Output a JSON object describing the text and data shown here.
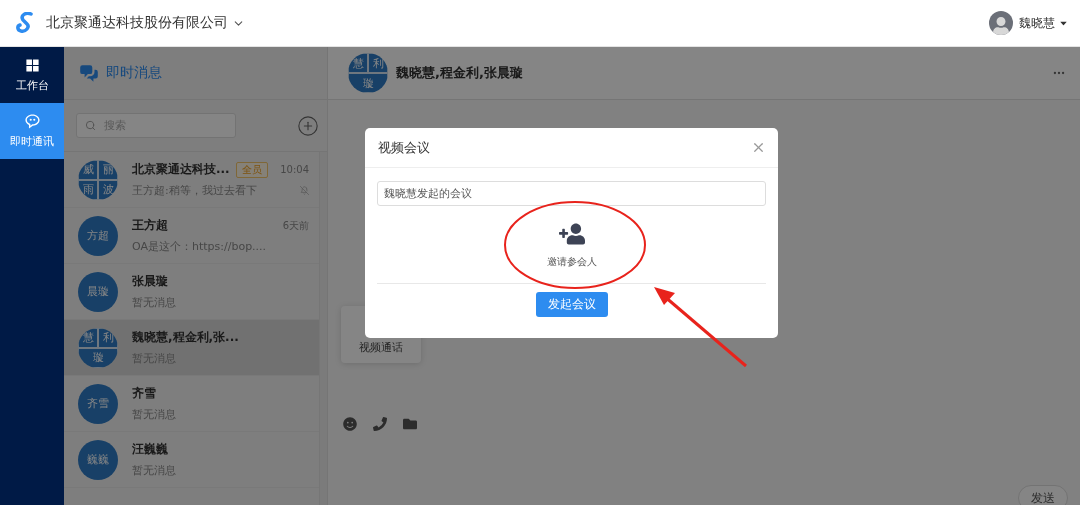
{
  "header": {
    "company": "北京聚通达科技股份有限公司",
    "user": "魏晓慧"
  },
  "nav": [
    {
      "label": "工作台",
      "selected": false
    },
    {
      "label": "即时通讯",
      "selected": true
    }
  ],
  "conversations": {
    "title": "即时消息",
    "search_placeholder": "搜索",
    "items": [
      {
        "avatar": [
          "威",
          "丽",
          "雨",
          "波"
        ],
        "name": "北京聚通达科技...",
        "tag": "全员",
        "time": "10:04",
        "preview": "王方超:稍等，我过去看下",
        "muted": true,
        "selected": false
      },
      {
        "avatar": [
          "方超"
        ],
        "name": "王方超",
        "time": "6天前",
        "preview": "OA是这个：https://bop....",
        "muted": false,
        "selected": false
      },
      {
        "avatar": [
          "晨璇"
        ],
        "name": "张晨璇",
        "preview": "暂无消息",
        "muted": false,
        "selected": false
      },
      {
        "avatar": [
          "慧",
          "利",
          "璇"
        ],
        "name": "魏晓慧,程金利,张...",
        "preview": "暂无消息",
        "muted": false,
        "selected": true
      },
      {
        "avatar": [
          "齐雪"
        ],
        "name": "齐雪",
        "preview": "暂无消息",
        "muted": false,
        "selected": false
      },
      {
        "avatar": [
          "巍巍"
        ],
        "name": "汪巍巍",
        "preview": "暂无消息",
        "muted": false,
        "selected": false
      }
    ]
  },
  "chat": {
    "title": "魏晓慧,程金利,张晨璇",
    "avatar": [
      "慧",
      "利",
      "璇"
    ],
    "popover": [
      "视频通话"
    ],
    "send": "发送"
  },
  "modal": {
    "title": "视频会议",
    "topic": "魏晓慧发起的会议",
    "invite_label": "邀请参会人",
    "start_button": "发起会议"
  },
  "annotation": {
    "kind": "circle_arrow"
  }
}
